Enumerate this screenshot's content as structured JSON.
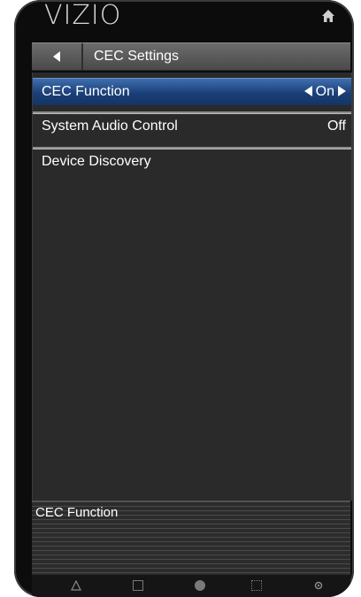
{
  "header": {
    "brand": "VIZIO",
    "home_icon": "home-icon"
  },
  "breadcrumb": {
    "back_icon": "back-arrow-icon",
    "title": "CEC Settings"
  },
  "menu": {
    "items": [
      {
        "label": "CEC Function",
        "value": "On",
        "selected": true
      },
      {
        "label": "System Audio Control",
        "value": "Off",
        "selected": false
      },
      {
        "label": "Device Discovery",
        "value": "",
        "selected": false
      }
    ]
  },
  "description": {
    "text": "CEC Function"
  },
  "bottom_bar": {
    "icons": [
      "triangle-icon",
      "square-icon",
      "circle-icon",
      "grid-icon",
      "gear-icon"
    ]
  },
  "colors": {
    "selected_row": "#1f4a8a",
    "panel_bg": "#2a2a2a",
    "device_frame": "#0c0c0c"
  }
}
